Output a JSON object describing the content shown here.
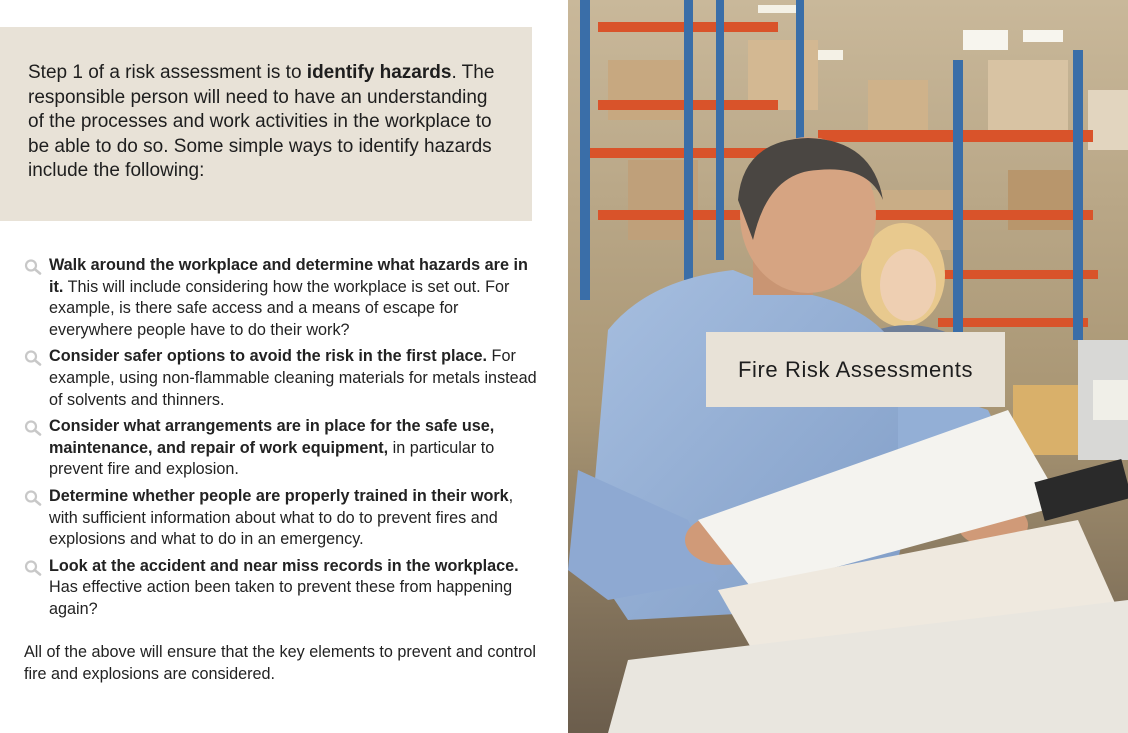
{
  "intro": {
    "pre": "Step 1 of a risk assessment is to ",
    "bold": "identify hazards",
    "post": ". The responsible person will need to have an understanding of the processes and work activities in the workplace to be able to do so. Some simple ways to identify hazards include the following:"
  },
  "items": [
    {
      "bold": "Walk around the workplace and determine what hazards are in it.",
      "text": " This will include considering how the workplace is set out. For example, is there safe access and a means of escape for everywhere people have to do their work?"
    },
    {
      "bold": "Consider safer options to avoid the risk in the first place.",
      "text": " For example, using non-flammable cleaning materials for metals instead of solvents and thinners."
    },
    {
      "bold": "Consider what arrangements are in place for the safe use, maintenance, and repair of work equipment,",
      "text": " in particular to prevent fire and explosion."
    },
    {
      "bold": "Determine whether people are properly trained in their work",
      "text": ", with sufficient information about what to do to prevent fires and explosions and what to do in an emergency."
    },
    {
      "bold": "Look at the accident and near miss records in the workplace.",
      "text": " Has effective action been taken to prevent these from happening again?"
    }
  ],
  "closing": "All of the above will ensure that the key elements to prevent and control fire and explosions are considered.",
  "title": "Fire Risk Assessments",
  "colors": {
    "panel": "#e8e2d7",
    "icon": "#c8c8c8",
    "shelf_orange": "#d9532a",
    "shelf_blue": "#3a6ea8"
  },
  "icons": {
    "bullet": "magnifier-icon"
  }
}
